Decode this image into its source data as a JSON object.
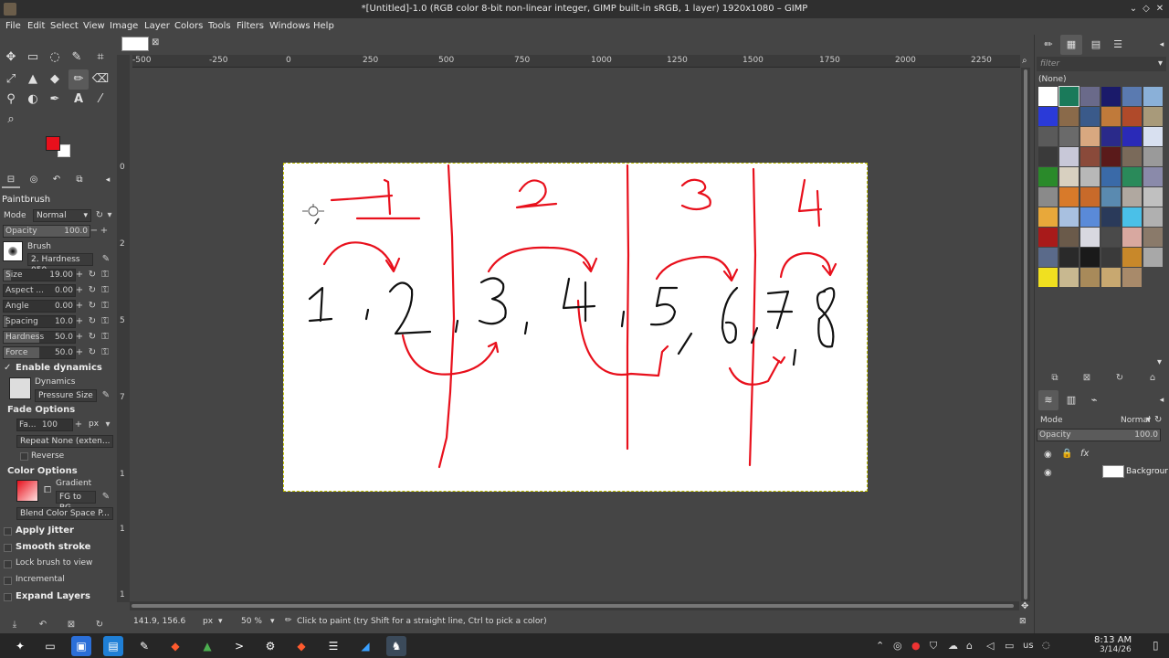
{
  "window": {
    "title": "*[Untitled]-1.0 (RGB color 8-bit non-linear integer, GIMP built-in sRGB, 1 layer) 1920x1080 – GIMP"
  },
  "menu": [
    "File",
    "Edit",
    "Select",
    "View",
    "Image",
    "Layer",
    "Colors",
    "Tools",
    "Filters",
    "Windows",
    "Help"
  ],
  "tool_options": {
    "tool_name": "Paintbrush",
    "mode_label": "Mode",
    "mode_value": "Normal",
    "opacity": {
      "label": "Opacity",
      "value": "100.0"
    },
    "brush_label": "Brush",
    "brush_value": "2. Hardness 050",
    "size": {
      "label": "Size",
      "value": "19.00"
    },
    "aspect": {
      "label": "Aspect ...",
      "value": "0.00"
    },
    "angle": {
      "label": "Angle",
      "value": "0.00"
    },
    "spacing": {
      "label": "Spacing",
      "value": "10.0"
    },
    "hardness": {
      "label": "Hardness",
      "value": "50.0"
    },
    "force": {
      "label": "Force",
      "value": "50.0"
    },
    "enable_dynamics": "Enable dynamics",
    "dynamics_label": "Dynamics",
    "dynamics_value": "Pressure Size",
    "fade_options": "Fade Options",
    "fade_label": "Fa...",
    "fade_value": "100",
    "fade_unit": "px",
    "repeat_value": "Repeat None (exten...",
    "reverse": "Reverse",
    "color_options": "Color Options",
    "gradient_label": "Gradient",
    "gradient_value": "FG to BG",
    "blend_space": "Blend Color Space P...",
    "apply_jitter": "Apply Jitter",
    "smooth_stroke": "Smooth stroke",
    "lock_brush": "Lock brush to view",
    "incremental": "Incremental",
    "expand_layers": "Expand Layers"
  },
  "colors": {
    "fg": "#e8101c",
    "bg": "#ffffff",
    "stroke_red": "#e8101c",
    "stroke_black": "#111111"
  },
  "ruler": {
    "h_labels": [
      "-500",
      "-250",
      "0",
      "250",
      "500",
      "750",
      "1000",
      "1250",
      "1500",
      "1750",
      "2000",
      "2250"
    ],
    "v_labels": [
      "0",
      "2",
      "5",
      "7",
      "1",
      "1",
      "1"
    ]
  },
  "status": {
    "coords": "141.9, 156.6",
    "unit": "px",
    "zoom": "50 %",
    "message": "Click to paint (try Shift for a straight line, Ctrl to pick a color)"
  },
  "right_dock": {
    "filter_placeholder": "filter",
    "pattern_name": "(None)",
    "layers": {
      "mode_label": "Mode",
      "mode_value": "Normal",
      "opacity_label": "Opacity",
      "opacity_value": "100.0",
      "layer_name": "Backgrour"
    }
  },
  "taskbar": {
    "lang": "us",
    "time": "8:13 AM",
    "date": "3/14/26"
  }
}
